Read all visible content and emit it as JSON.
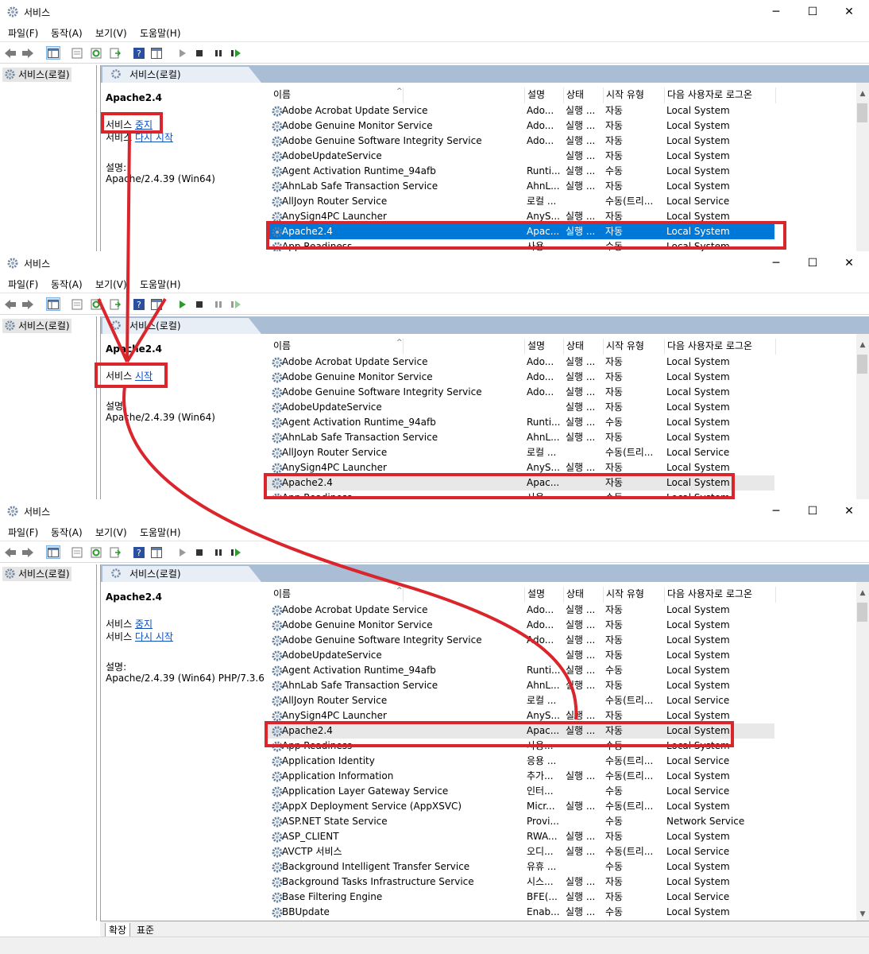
{
  "window": {
    "title": "서비스",
    "menu": [
      "파일(F)",
      "동작(A)",
      "보기(V)",
      "도움말(H)"
    ],
    "tree_root": "서비스(로컬)",
    "header_tab": "서비스(로컬)"
  },
  "columns": [
    "이름",
    "설명",
    "상태",
    "시작 유형",
    "다음 사용자로 로그온"
  ],
  "panels": [
    {
      "name": "Apache2.4",
      "action1_prefix": "서비스 ",
      "action1_link": "중지",
      "action2_prefix": "서비스 ",
      "action2_link": "다시 시작",
      "desc_label": "설명:",
      "desc_text": "Apache/2.4.39 (Win64)"
    },
    {
      "name": "Apache2.4",
      "action1_prefix": "서비스 ",
      "action1_link": "시작",
      "desc_label": "설명:",
      "desc_text": "Apache/2.4.39 (Win64)"
    },
    {
      "name": "Apache2.4",
      "action1_prefix": "서비스 ",
      "action1_link": "중지",
      "action2_prefix": "서비스 ",
      "action2_link": "다시 시작",
      "desc_label": "설명:",
      "desc_text": "Apache/2.4.39 (Win64) PHP/7.3.6"
    }
  ],
  "rows_common": [
    [
      "Adobe Acrobat Update Service",
      "Ado...",
      "실행 ...",
      "자동",
      "Local System"
    ],
    [
      "Adobe Genuine Monitor Service",
      "Ado...",
      "실행 ...",
      "자동",
      "Local System"
    ],
    [
      "Adobe Genuine Software Integrity Service",
      "Ado...",
      "실행 ...",
      "자동",
      "Local System"
    ],
    [
      "AdobeUpdateService",
      "",
      "실행 ...",
      "자동",
      "Local System"
    ],
    [
      "Agent Activation Runtime_94afb",
      "Runti...",
      "실행 ...",
      "수동",
      "Local System"
    ],
    [
      "AhnLab Safe Transaction Service",
      "AhnL...",
      "실행 ...",
      "자동",
      "Local System"
    ],
    [
      "AllJoyn Router Service",
      "로컬 ...",
      "",
      "수동(트리...",
      "Local Service"
    ],
    [
      "AnySign4PC Launcher",
      "AnyS...",
      "실행 ...",
      "자동",
      "Local System"
    ]
  ],
  "apache_rows": [
    [
      "Apache2.4",
      "Apac...",
      "실행 ...",
      "자동",
      "Local System"
    ],
    [
      "Apache2.4",
      "Apac...",
      "",
      "자동",
      "Local System"
    ],
    [
      "Apache2.4",
      "Apac...",
      "실행 ...",
      "자동",
      "Local System"
    ]
  ],
  "rows_extra": [
    [
      "App Readiness",
      "사용...",
      "",
      "수동",
      "Local System"
    ],
    [
      "Application Identity",
      "응용 ...",
      "",
      "수동(트리...",
      "Local Service"
    ],
    [
      "Application Information",
      "추가...",
      "실행 ...",
      "수동(트리...",
      "Local System"
    ],
    [
      "Application Layer Gateway Service",
      "인터...",
      "",
      "수동",
      "Local Service"
    ],
    [
      "AppX Deployment Service (AppXSVC)",
      "Micr...",
      "실행 ...",
      "수동(트리...",
      "Local System"
    ],
    [
      "ASP.NET State Service",
      "Provi...",
      "",
      "수동",
      "Network Service"
    ],
    [
      "ASP_CLIENT",
      "RWA...",
      "실행 ...",
      "자동",
      "Local System"
    ],
    [
      "AVCTP 서비스",
      "오디...",
      "실행 ...",
      "수동(트리...",
      "Local Service"
    ],
    [
      "Background Intelligent Transfer Service",
      "유휴 ...",
      "",
      "수동",
      "Local System"
    ],
    [
      "Background Tasks Infrastructure Service",
      "시스...",
      "실행 ...",
      "자동",
      "Local System"
    ],
    [
      "Base Filtering Engine",
      "BFE(...",
      "실행 ...",
      "자동",
      "Local Service"
    ],
    [
      "BBUpdate",
      "Enab...",
      "실행 ...",
      "수동",
      "Local System"
    ]
  ],
  "bottom_tabs": [
    "확장",
    "표준"
  ],
  "colors": {
    "selection": "#0078d7",
    "annotation": "#d9252b",
    "link": "#0c4fbd",
    "header_band": "#a9bdd5"
  }
}
